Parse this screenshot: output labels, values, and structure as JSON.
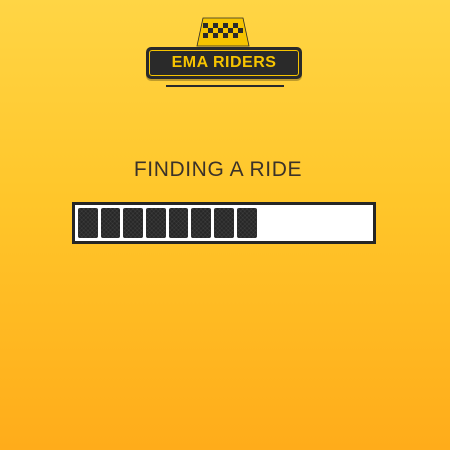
{
  "brand": {
    "name": "EMA RIDERS",
    "icon": "taxi-sign-icon",
    "colors": {
      "accent": "#f6c400",
      "dark": "#2a2a2a"
    }
  },
  "status": {
    "title": "FINDING A RIDE"
  },
  "progress": {
    "filled_segments": 8,
    "total_segments": 13,
    "fraction": 0.615
  },
  "colors": {
    "background_top": "#ffd545",
    "background_bottom": "#ffac1a",
    "bar_fill": "#272727",
    "bar_track": "#ffffff"
  }
}
